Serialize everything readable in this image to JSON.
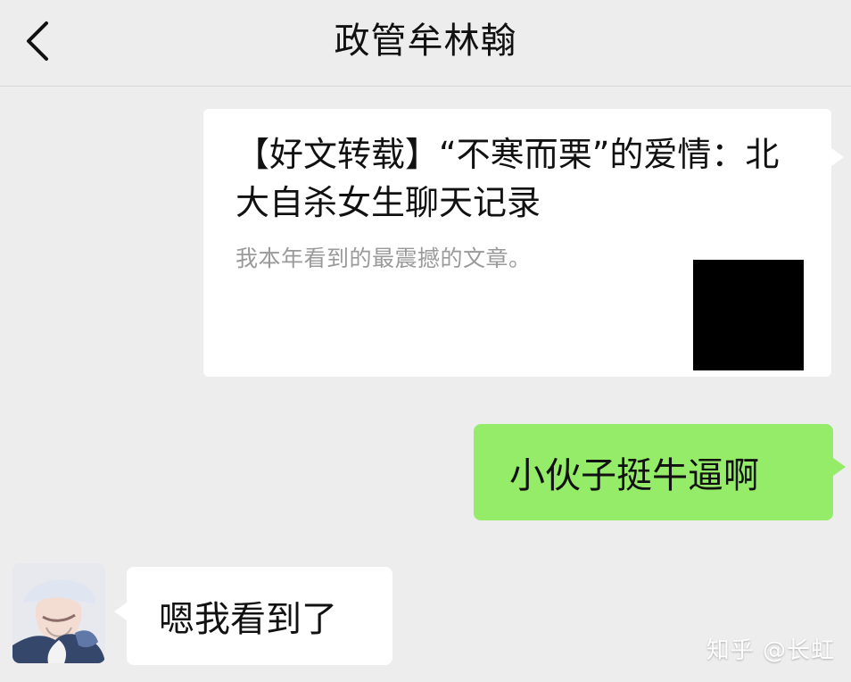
{
  "header": {
    "title": "政管牟林翰",
    "back_icon": "chevron-left-icon"
  },
  "article_card": {
    "title": "【好文转载】“不寒而栗”的爱情：北大自杀女生聊天记录",
    "description": "我本年看到的最震撼的文章。"
  },
  "messages": {
    "outgoing": "小伙子挺牛逼啊",
    "incoming": "嗯我看到了"
  },
  "watermark": {
    "text": "知乎 @长虹"
  },
  "colors": {
    "background": "#ededed",
    "outgoing_bubble": "#95ec69",
    "incoming_bubble": "#ffffff",
    "card_background": "#ffffff",
    "thumbnail": "#000000"
  }
}
